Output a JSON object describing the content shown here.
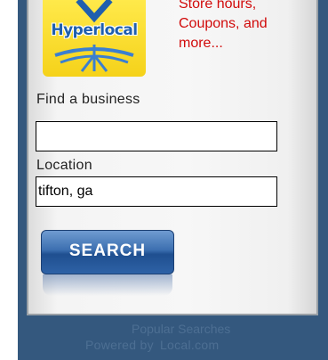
{
  "logo": {
    "text": "Hyperlocal"
  },
  "promo": {
    "text": "Store hours,\nCoupons, and\nmore..."
  },
  "form": {
    "find_label": "Find a business",
    "business_value": "",
    "location_label": "Location",
    "location_value": "tifton, ga",
    "search_label": "SEARCH"
  },
  "footer": {
    "popular_searches": "Popular Searches",
    "powered_by": "Powered by",
    "brand": "Local.com"
  },
  "colors": {
    "frame": "#34587e",
    "promo_text": "#d10a0a",
    "button": "#3c6fb0",
    "logo_bg": "#f5d21a",
    "logo_text": "#1f5fae"
  }
}
